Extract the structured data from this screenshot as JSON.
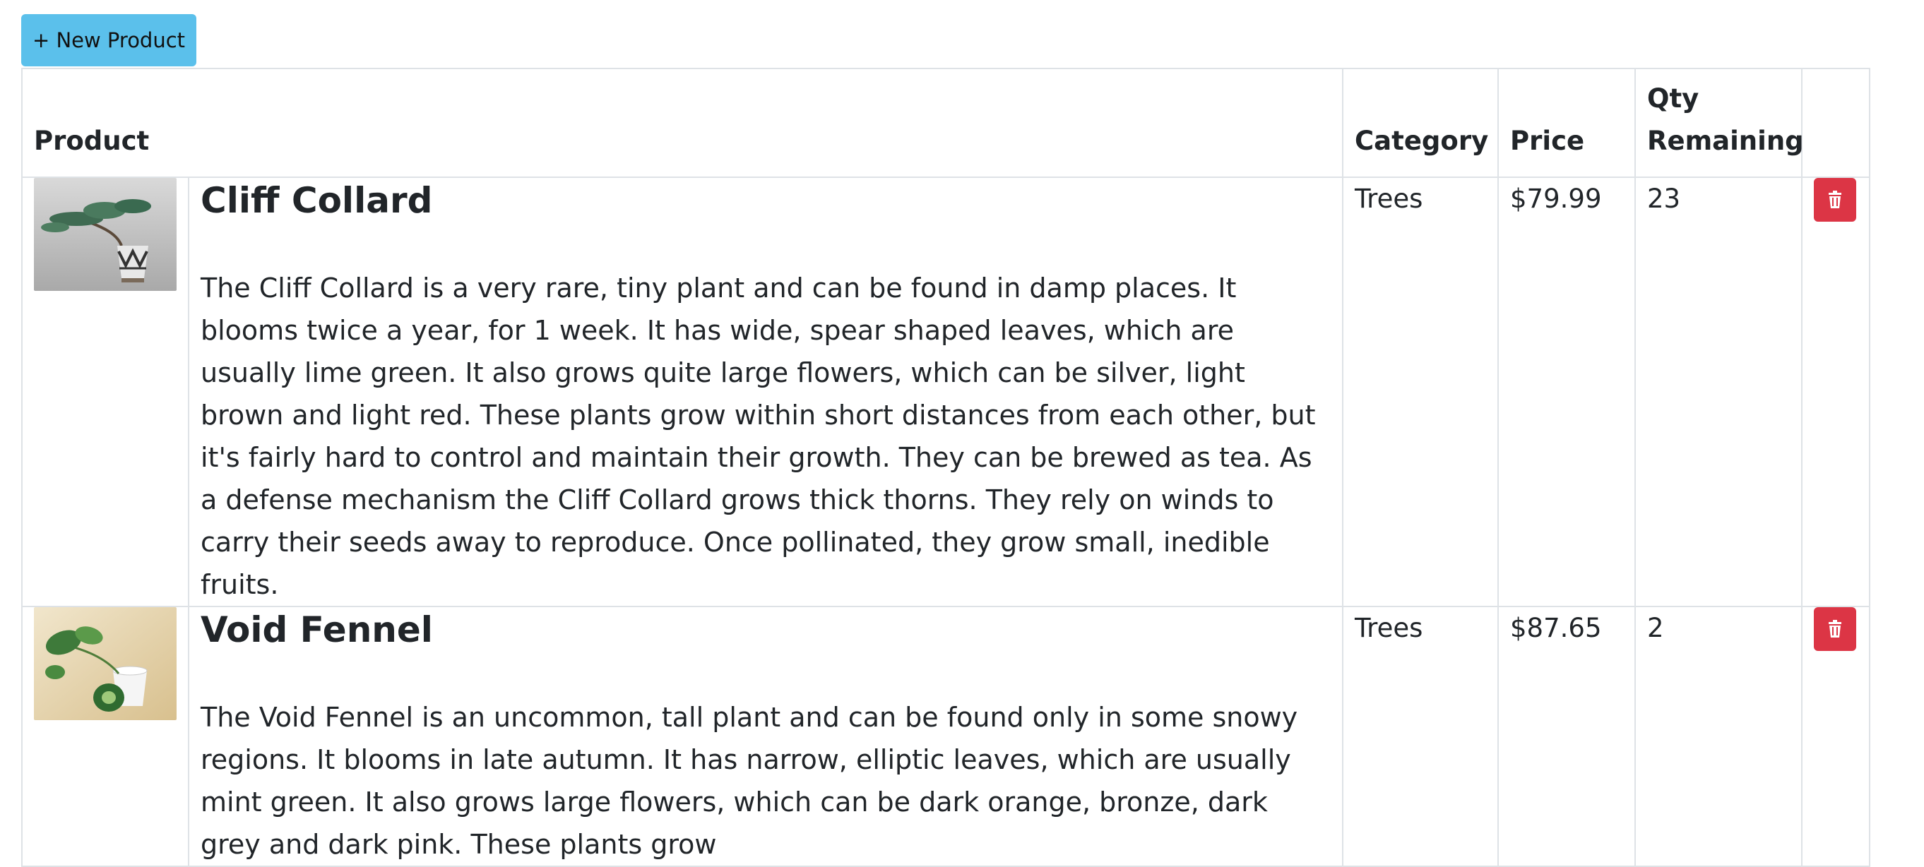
{
  "toolbar": {
    "new_product_label": "+ New Product"
  },
  "table": {
    "headers": {
      "product": "Product",
      "category": "Category",
      "price": "Price",
      "qty_line1": "Qty",
      "qty_line2": "Remaining"
    },
    "rows": [
      {
        "name": "Cliff Collard",
        "description": "The Cliff Collard is a very rare, tiny plant and can be found in damp places. It blooms twice a year, for 1 week. It has wide, spear shaped leaves, which are usually lime green. It also grows quite large flowers, which can be silver, light brown and light red. These plants grow within short distances from each other, but it's fairly hard to control and maintain their growth. They can be brewed as tea. As a defense mechanism the Cliff Collard grows thick thorns. They rely on winds to carry their seeds away to reproduce. Once pollinated, they grow small, inedible fruits.",
        "category": "Trees",
        "price": "$79.99",
        "qty": "23",
        "image": "bonsai-plant-photo"
      },
      {
        "name": "Void Fennel",
        "description": "The Void Fennel is an uncommon, tall plant and can be found only in some snowy regions. It blooms in late autumn. It has narrow, elliptic leaves, which are usually mint green. It also grows large flowers, which can be dark orange, bronze, dark grey and dark pink. These plants grow",
        "category": "Trees",
        "price": "$87.65",
        "qty": "2",
        "image": "potted-plant-cup-photo"
      }
    ]
  },
  "colors": {
    "new_button": "#5bc0eb",
    "delete_button": "#dc3545",
    "border": "#dee2e6",
    "text": "#212529"
  },
  "icons": {
    "delete": "trash-icon"
  }
}
